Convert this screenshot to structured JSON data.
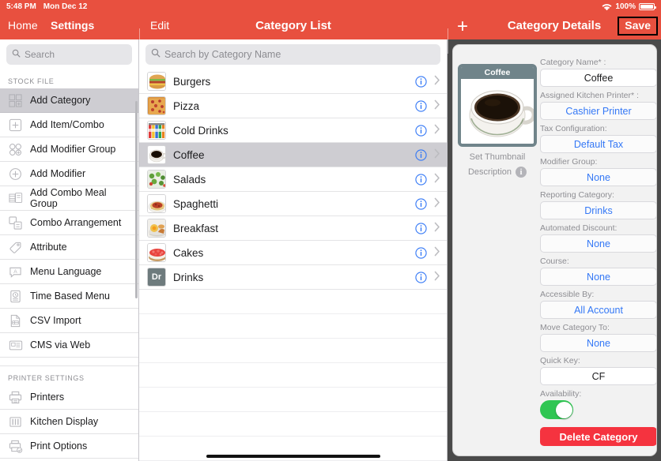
{
  "status": {
    "time": "5:48 PM",
    "date": "Mon Dec 12",
    "battery": "100%",
    "wifi_icon": "wifi-icon",
    "battery_icon": "battery-icon"
  },
  "nav": {
    "home": "Home",
    "settings": "Settings",
    "edit": "Edit",
    "category_list": "Category List",
    "plus": "+",
    "category_details": "Category Details",
    "save": "Save"
  },
  "sidebar": {
    "search_placeholder": "Search",
    "search_icon": "search-icon",
    "groups": [
      {
        "header": "STOCK FILE",
        "items": [
          {
            "label": "Add Category",
            "icon": "add-category-icon",
            "selected": true
          },
          {
            "label": "Add Item/Combo",
            "icon": "add-item-combo-icon",
            "selected": false
          },
          {
            "label": "Add Modifier Group",
            "icon": "add-modifier-group-icon",
            "selected": false
          },
          {
            "label": "Add Modifier",
            "icon": "add-modifier-icon",
            "selected": false
          },
          {
            "label": "Add Combo Meal Group",
            "icon": "add-combo-meal-group-icon",
            "selected": false
          },
          {
            "label": "Combo Arrangement",
            "icon": "combo-arrangement-icon",
            "selected": false
          },
          {
            "label": "Attribute",
            "icon": "attribute-tag-icon",
            "selected": false
          },
          {
            "label": "Menu Language",
            "icon": "menu-language-icon",
            "selected": false
          },
          {
            "label": "Time Based Menu",
            "icon": "time-based-menu-icon",
            "selected": false
          },
          {
            "label": "CSV Import",
            "icon": "csv-import-icon",
            "selected": false
          },
          {
            "label": "CMS via Web",
            "icon": "cms-via-web-icon",
            "selected": false
          }
        ]
      },
      {
        "header": "PRINTER SETTINGS",
        "items": [
          {
            "label": "Printers",
            "icon": "printer-icon",
            "selected": false
          },
          {
            "label": "Kitchen Display",
            "icon": "kitchen-display-icon",
            "selected": false
          },
          {
            "label": "Print Options",
            "icon": "print-options-icon",
            "selected": false
          }
        ]
      }
    ]
  },
  "category_list": {
    "search_placeholder": "Search by Category Name",
    "search_icon": "search-icon",
    "rows": [
      {
        "label": "Burgers",
        "thumb": "burger-thumbnail",
        "selected": false,
        "info_icon": "info-icon",
        "chevron": "chevron-right-icon"
      },
      {
        "label": "Pizza",
        "thumb": "pizza-thumbnail",
        "selected": false,
        "info_icon": "info-icon",
        "chevron": "chevron-right-icon"
      },
      {
        "label": "Cold Drinks",
        "thumb": "cold-drinks-thumbnail",
        "selected": false,
        "info_icon": "info-icon",
        "chevron": "chevron-right-icon"
      },
      {
        "label": "Coffee",
        "thumb": "coffee-thumbnail",
        "selected": true,
        "info_icon": "info-icon",
        "chevron": "chevron-right-icon"
      },
      {
        "label": "Salads",
        "thumb": "salad-thumbnail",
        "selected": false,
        "info_icon": "info-icon",
        "chevron": "chevron-right-icon"
      },
      {
        "label": "Spaghetti",
        "thumb": "spaghetti-thumbnail",
        "selected": false,
        "info_icon": "info-icon",
        "chevron": "chevron-right-icon"
      },
      {
        "label": "Breakfast",
        "thumb": "breakfast-thumbnail",
        "selected": false,
        "info_icon": "info-icon",
        "chevron": "chevron-right-icon"
      },
      {
        "label": "Cakes",
        "thumb": "cakes-thumbnail",
        "selected": false,
        "info_icon": "info-icon",
        "chevron": "chevron-right-icon"
      },
      {
        "label": "Drinks",
        "thumb": "drinks-initials-Dr",
        "selected": false,
        "info_icon": "info-icon",
        "chevron": "chevron-right-icon"
      }
    ],
    "empty_rows": 7
  },
  "details": {
    "thumbnail_title": "Coffee",
    "thumbnail_icon": "coffee-cup-image",
    "set_thumbnail": "Set Thumbnail",
    "description": "Description",
    "description_info_icon": "info-icon-gray",
    "fields": [
      {
        "label": "Category Name* :",
        "value": "Coffee",
        "style": "white"
      },
      {
        "label": "Assigned Kitchen Printer* :",
        "value": "Cashier Printer",
        "style": "link"
      },
      {
        "label": "Tax Configuration:",
        "value": "Default Tax",
        "style": "link"
      },
      {
        "label": "Modifier Group:",
        "value": "None",
        "style": "link"
      },
      {
        "label": "Reporting Category:",
        "value": "Drinks",
        "style": "link"
      },
      {
        "label": "Automated Discount:",
        "value": "None",
        "style": "link"
      },
      {
        "label": "Course:",
        "value": "None",
        "style": "link"
      },
      {
        "label": "Accessible By:",
        "value": "All Account",
        "style": "link"
      },
      {
        "label": "Move Category To:",
        "value": "None",
        "style": "link"
      },
      {
        "label": "Quick Key:",
        "value": "CF",
        "style": "white"
      }
    ],
    "availability_label": "Availability:",
    "availability_on": true,
    "delete_label": "Delete Category"
  },
  "colors": {
    "header_red": "#e8503f",
    "link_blue": "#3478f6",
    "toggle_green": "#30c653",
    "delete_red": "#f5333f",
    "thumb_border": "#70848a",
    "selected_row": "#cecdd2"
  }
}
